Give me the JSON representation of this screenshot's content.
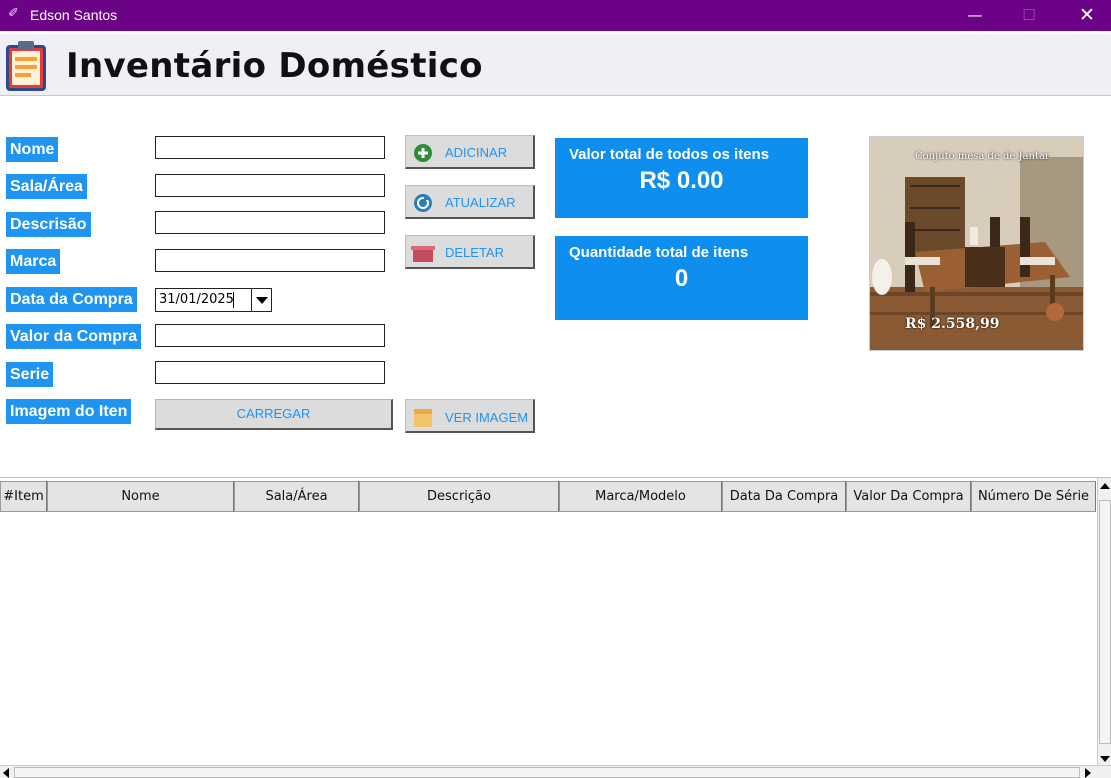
{
  "window": {
    "title": "Edson Santos",
    "minimize": "—",
    "maximize": "☐",
    "close": "✕"
  },
  "header": {
    "title": "Inventário Doméstico",
    "icon": "clipboard-icon"
  },
  "form": {
    "fields": [
      {
        "label": "Nome",
        "value": ""
      },
      {
        "label": "Sala/Área",
        "value": ""
      },
      {
        "label": "Descrisão",
        "value": ""
      },
      {
        "label": "Marca",
        "value": ""
      },
      {
        "label": "Data da Compra",
        "value": "31/01/2025"
      },
      {
        "label": "Valor da Compra",
        "value": ""
      },
      {
        "label": "Serie",
        "value": ""
      },
      {
        "label": "Imagem do Iten",
        "value": ""
      }
    ],
    "upload_button": "CARREGAR"
  },
  "actions": {
    "add": {
      "label": "ADICINAR",
      "icon": "plus-icon"
    },
    "update": {
      "label": "ATUALIZAR",
      "icon": "refresh-icon"
    },
    "delete": {
      "label": "DELETAR",
      "icon": "trash-icon"
    },
    "view_image": {
      "label": "VER IMAGEM",
      "icon": "image-box-icon"
    }
  },
  "stats": {
    "total_value_label": "Valor total de todos os itens",
    "total_value": "R$ 0.00",
    "total_qty_label": "Quantidade total de itens",
    "total_qty": "0"
  },
  "product_image": {
    "title": "Conjuto mesa de de Jantar",
    "price": "R$ 2.558,99"
  },
  "table": {
    "columns": [
      "#Item",
      "Nome",
      "Sala/Área",
      "Descrição",
      "Marca/Modelo",
      "Data Da Compra",
      "Valor Da Compra",
      "Número De Série"
    ],
    "rows": []
  },
  "colors": {
    "titlebar": "#6c0286",
    "accent": "#1f94f0",
    "stat_bg": "#0e8ff0"
  }
}
